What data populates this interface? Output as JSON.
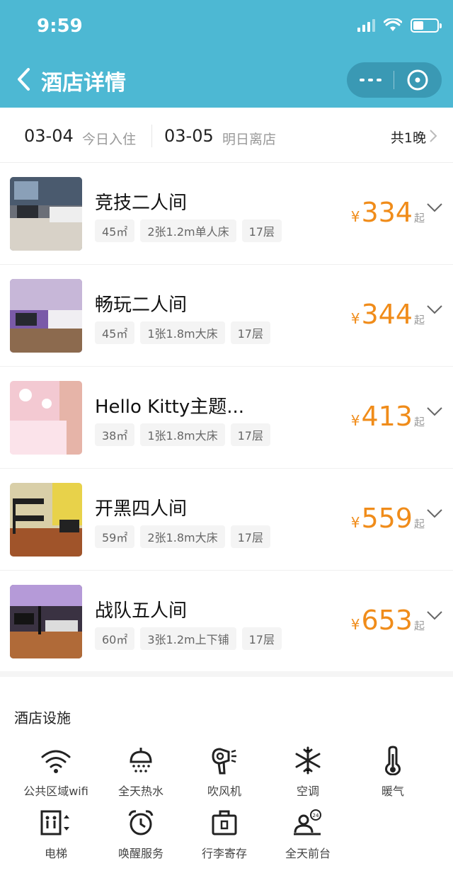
{
  "status": {
    "time": "9:59"
  },
  "nav": {
    "title": "酒店详情"
  },
  "dates": {
    "check_in": "03-04",
    "check_in_label": "今日入住",
    "check_out": "03-05",
    "check_out_label": "明日离店",
    "nights": "共1晚"
  },
  "rooms": [
    {
      "name": "竞技二人间",
      "area": "45㎡",
      "bed": "2张1.2m单人床",
      "floor": "17层",
      "currency": "¥",
      "price": "334",
      "suffix": "起"
    },
    {
      "name": "畅玩二人间",
      "area": "45㎡",
      "bed": "1张1.8m大床",
      "floor": "17层",
      "currency": "¥",
      "price": "344",
      "suffix": "起"
    },
    {
      "name": "Hello Kitty主题...",
      "area": "38㎡",
      "bed": "1张1.8m大床",
      "floor": "17层",
      "currency": "¥",
      "price": "413",
      "suffix": "起"
    },
    {
      "name": "开黑四人间",
      "area": "59㎡",
      "bed": "2张1.8m大床",
      "floor": "17层",
      "currency": "¥",
      "price": "559",
      "suffix": "起"
    },
    {
      "name": "战队五人间",
      "area": "60㎡",
      "bed": "3张1.2m上下铺",
      "floor": "17层",
      "currency": "¥",
      "price": "653",
      "suffix": "起"
    }
  ],
  "facilities": {
    "title": "酒店设施",
    "items": [
      {
        "label": "公共区域wifi",
        "icon": "wifi-icon"
      },
      {
        "label": "全天热水",
        "icon": "shower-icon"
      },
      {
        "label": "吹风机",
        "icon": "hairdryer-icon"
      },
      {
        "label": "空调",
        "icon": "snowflake-icon"
      },
      {
        "label": "暖气",
        "icon": "thermometer-icon"
      },
      {
        "label": "电梯",
        "icon": "elevator-icon"
      },
      {
        "label": "唤醒服务",
        "icon": "alarm-clock-icon"
      },
      {
        "label": "行李寄存",
        "icon": "luggage-icon"
      },
      {
        "label": "全天前台",
        "icon": "reception-icon"
      }
    ]
  },
  "colors": {
    "header": "#4db8d3",
    "price": "#f08c1a"
  }
}
